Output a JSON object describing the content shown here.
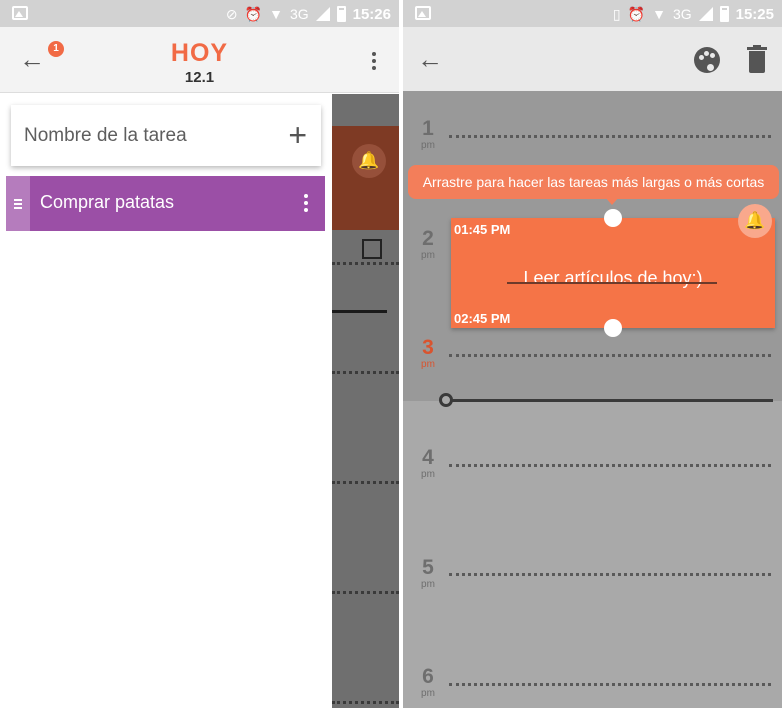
{
  "left_screen": {
    "status_bar": {
      "time": "15:26",
      "network": "3G"
    },
    "app_bar": {
      "badge_count": "1",
      "title": "HOY",
      "subtitle": "12.1"
    },
    "drawer": {
      "input": {
        "placeholder": "Nombre de la tarea",
        "value": ""
      },
      "tasks": [
        {
          "label": "Comprar patatas",
          "color": "#9b4fa6"
        }
      ]
    },
    "colors": {
      "accent": "#f16a45",
      "task_purple": "#9b4fa6"
    }
  },
  "right_screen": {
    "status_bar": {
      "time": "15:25",
      "network": "3G"
    },
    "hours": [
      {
        "num": "1",
        "period": "pm",
        "current": false
      },
      {
        "num": "2",
        "period": "pm",
        "current": false
      },
      {
        "num": "3",
        "period": "pm",
        "current": true
      },
      {
        "num": "4",
        "period": "pm",
        "current": false
      },
      {
        "num": "5",
        "period": "pm",
        "current": false
      },
      {
        "num": "6",
        "period": "pm",
        "current": false
      }
    ],
    "tooltip": "Arrastre para hacer las tareas más largas o más cortas",
    "event": {
      "start_time": "01:45 PM",
      "end_time": "02:45 PM",
      "title": "Leer artículos de hoy:)",
      "color": "#f57447"
    },
    "icons": [
      "back-arrow-icon",
      "palette-icon",
      "trash-icon"
    ],
    "colors": {
      "event_orange": "#f57447",
      "current_hour": "#d9542f"
    }
  }
}
